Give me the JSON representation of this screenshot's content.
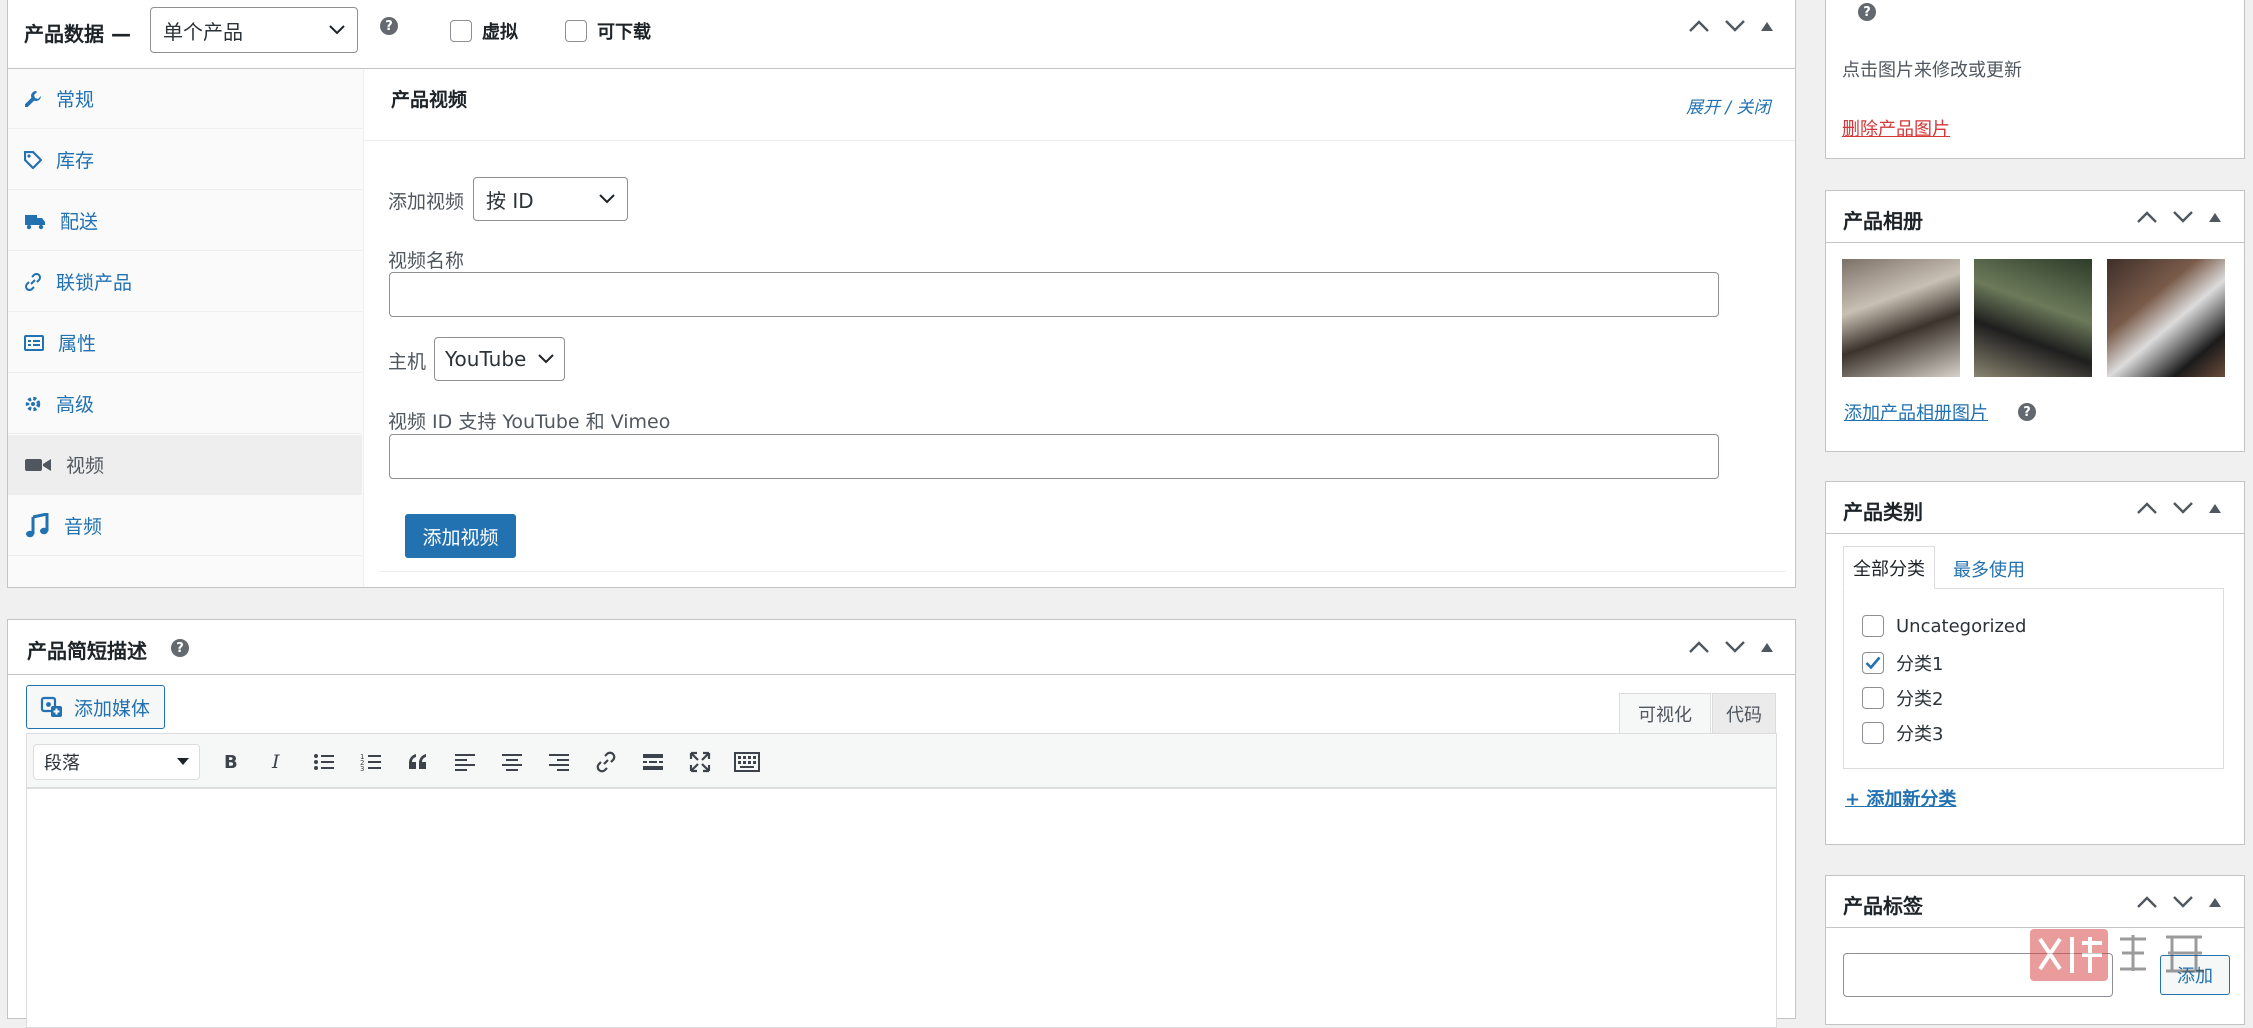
{
  "product_data": {
    "title": "产品数据 —",
    "type_select": "单个产品",
    "virtual_label": "虚拟",
    "downloadable_label": "可下载",
    "tabs": [
      {
        "label": "常规",
        "icon": "wrench-icon"
      },
      {
        "label": "库存",
        "icon": "tag-icon"
      },
      {
        "label": "配送",
        "icon": "truck-icon"
      },
      {
        "label": "联锁产品",
        "icon": "link-icon"
      },
      {
        "label": "属性",
        "icon": "list-icon"
      },
      {
        "label": "高级",
        "icon": "gear-icon"
      },
      {
        "label": "视频",
        "icon": "video-icon"
      },
      {
        "label": "音频",
        "icon": "music-icon"
      }
    ],
    "video_panel": {
      "title": "产品视频",
      "toggle": "展开 / 关闭",
      "add_video_label": "添加视频",
      "add_video_select": "按 ID",
      "video_name_label": "视频名称",
      "host_label": "主机",
      "host_select": "YouTube",
      "video_id_label": "视频 ID 支持 YouTube 和 Vimeo",
      "add_video_button": "添加视频"
    }
  },
  "short_desc": {
    "title": "产品简短描述",
    "add_media": "添加媒体",
    "tab_visual": "可视化",
    "tab_code": "代码",
    "format_select": "段落"
  },
  "sidebar": {
    "image_hint": "点击图片来修改或更新",
    "remove_image": "删除产品图片",
    "gallery": {
      "title": "产品相册",
      "add_link": "添加产品相册图片"
    },
    "categories": {
      "title": "产品类别",
      "tab_all": "全部分类",
      "tab_most": "最多使用",
      "items": [
        {
          "label": "Uncategorized",
          "checked": false
        },
        {
          "label": "分类1",
          "checked": true
        },
        {
          "label": "分类2",
          "checked": false
        },
        {
          "label": "分类3",
          "checked": false
        }
      ],
      "add_new": "+ 添加新分类"
    },
    "tags": {
      "title": "产品标签",
      "add_button": "添加"
    }
  },
  "colors": {
    "accent": "#2271b1",
    "danger": "#d63638",
    "border": "#c3c4c7"
  }
}
